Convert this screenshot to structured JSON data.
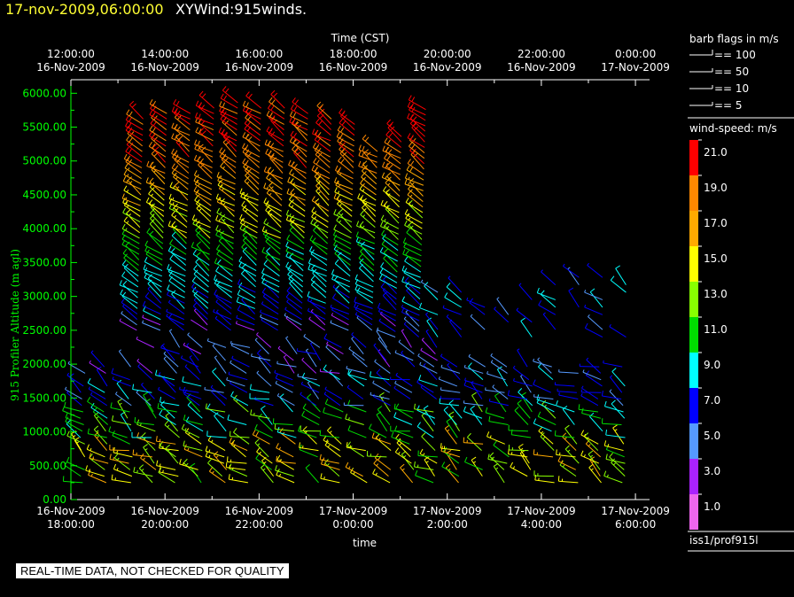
{
  "header": {
    "date": "17-nov-2009,06:00:00",
    "name": "XYWind:915winds."
  },
  "notice": "REAL-TIME DATA, NOT CHECKED FOR QUALITY",
  "legend": {
    "barb_title": "barb flags in m/s",
    "barbs": [
      "== 100",
      "== 50",
      "== 10",
      "== 5"
    ],
    "speed_title": "wind-speed: m/s",
    "speed_labels": [
      "21.0",
      "19.0",
      "17.0",
      "15.0",
      "13.0",
      "11.0",
      "9.0",
      "7.0",
      "5.0",
      "3.0",
      "1.0"
    ],
    "speed_colors": [
      "#ff0000",
      "#ff8800",
      "#ffaa00",
      "#ffff00",
      "#88ff00",
      "#00dd00",
      "#00ffff",
      "#0000ff",
      "#5599ff",
      "#aa22ff",
      "#ee66ee"
    ],
    "source": "iss1/prof915l"
  },
  "chart_data": {
    "type": "wind-barb",
    "top_axis": {
      "label": "Time (CST)",
      "ticks": [
        {
          "time": "12:00:00",
          "date": "16-Nov-2009"
        },
        {
          "time": "14:00:00",
          "date": "16-Nov-2009"
        },
        {
          "time": "16:00:00",
          "date": "16-Nov-2009"
        },
        {
          "time": "18:00:00",
          "date": "16-Nov-2009"
        },
        {
          "time": "20:00:00",
          "date": "16-Nov-2009"
        },
        {
          "time": "22:00:00",
          "date": "16-Nov-2009"
        },
        {
          "time": "0:00:00",
          "date": "17-Nov-2009"
        }
      ]
    },
    "bottom_axis": {
      "label": "time",
      "ticks": [
        {
          "date": "16-Nov-2009",
          "time": "18:00:00"
        },
        {
          "date": "16-Nov-2009",
          "time": "20:00:00"
        },
        {
          "date": "16-Nov-2009",
          "time": "22:00:00"
        },
        {
          "date": "17-Nov-2009",
          "time": "0:00:00"
        },
        {
          "date": "17-Nov-2009",
          "time": "2:00:00"
        },
        {
          "date": "17-Nov-2009",
          "time": "4:00:00"
        },
        {
          "date": "17-Nov-2009",
          "time": "6:00:00"
        }
      ],
      "range_hours": [
        18,
        30.3
      ]
    },
    "y_axis": {
      "label": "915 Profiler Altitude (m agl)",
      "ticks": [
        "0.00",
        "500.00",
        "1000.00",
        "1500.00",
        "2000.00",
        "2500.00",
        "3000.00",
        "3500.00",
        "4000.00",
        "4500.00",
        "5000.00",
        "5500.00",
        "6000.00"
      ],
      "ylim": [
        0,
        6200
      ],
      "unit": "m agl"
    }
  }
}
